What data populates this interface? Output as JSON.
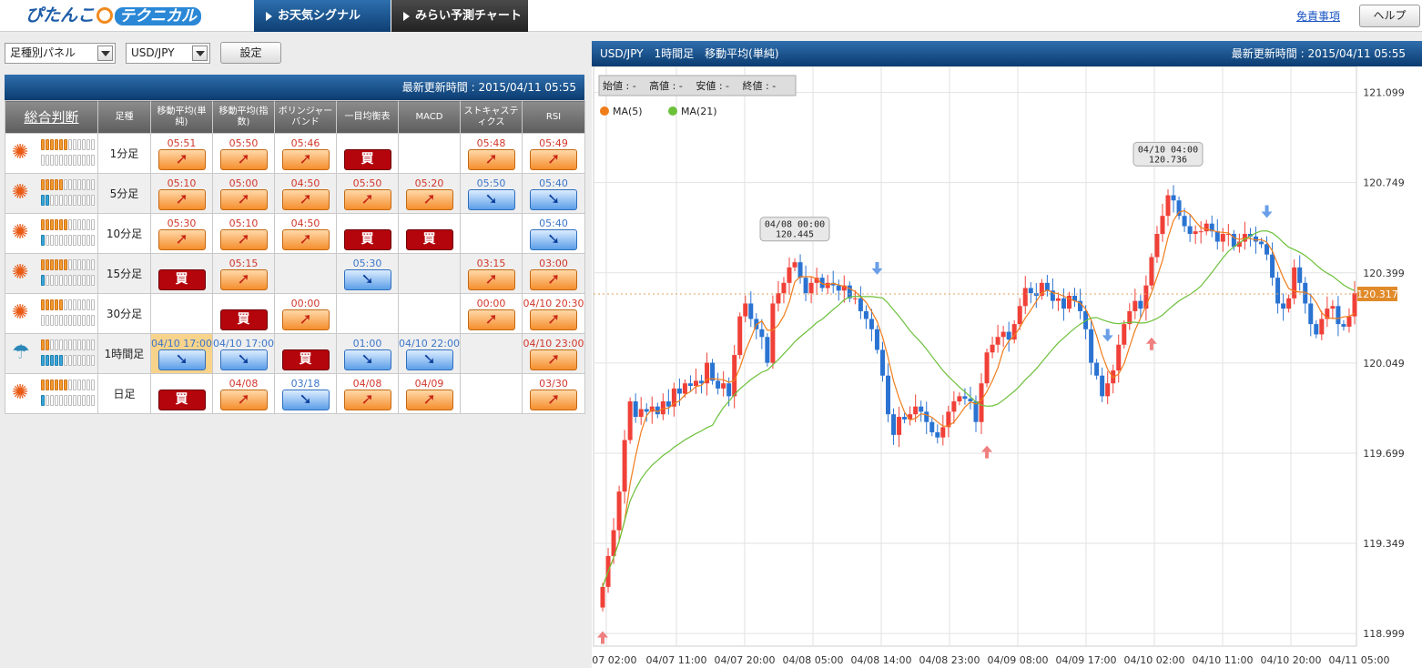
{
  "header": {
    "tab1": "お天気シグナル",
    "tab2": "みらい予測チャート",
    "disclaimer": "免責事項",
    "help": "ヘルプ"
  },
  "logo": {
    "a": "ぴたんこ",
    "b": "テクニカル"
  },
  "controls": {
    "panel": "足種別パネル",
    "pair": "USD/JPY",
    "settings": "設定"
  },
  "panel": {
    "updated": "最新更新時間 : 2015/04/11 05:55",
    "columns": [
      "総合判断",
      "足種",
      "移動平均(単純)",
      "移動平均(指数)",
      "ボリンジャーバンド",
      "一目均衡表",
      "MACD",
      "ストキャスティクス",
      "RSI"
    ],
    "rows": [
      {
        "tf": "1分足",
        "w": "sun",
        "up": 6,
        "dn": 0,
        "c": [
          [
            "05:51",
            "o"
          ],
          [
            "05:50",
            "o"
          ],
          [
            "05:46",
            "o"
          ],
          [
            "",
            "k"
          ],
          [
            "",
            ""
          ],
          [
            "05:48",
            "o"
          ],
          [
            "05:49",
            "o"
          ]
        ]
      },
      {
        "tf": "5分足",
        "w": "sun",
        "up": 5,
        "dn": 2,
        "c": [
          [
            "05:10",
            "o"
          ],
          [
            "05:00",
            "o"
          ],
          [
            "04:50",
            "o"
          ],
          [
            "05:50",
            "o"
          ],
          [
            "05:20",
            "o"
          ],
          [
            "05:50",
            "b"
          ],
          [
            "05:40",
            "b"
          ]
        ]
      },
      {
        "tf": "10分足",
        "w": "sun",
        "up": 6,
        "dn": 1,
        "c": [
          [
            "05:30",
            "o"
          ],
          [
            "05:10",
            "o"
          ],
          [
            "04:50",
            "o"
          ],
          [
            "",
            "k"
          ],
          [
            "",
            "k"
          ],
          [
            "",
            ""
          ],
          [
            "05:40",
            "b"
          ]
        ]
      },
      {
        "tf": "15分足",
        "w": "sun",
        "up": 6,
        "dn": 1,
        "c": [
          [
            "",
            "k"
          ],
          [
            "05:15",
            "o"
          ],
          [
            "",
            ""
          ],
          [
            "05:30",
            "b"
          ],
          [
            "",
            ""
          ],
          [
            "03:15",
            "o"
          ],
          [
            "03:00",
            "o"
          ]
        ]
      },
      {
        "tf": "30分足",
        "w": "sun",
        "up": 5,
        "dn": 0,
        "c": [
          [
            "",
            ""
          ],
          [
            "",
            "k"
          ],
          [
            "00:00",
            "o"
          ],
          [
            "",
            ""
          ],
          [
            "",
            ""
          ],
          [
            "00:00",
            "o"
          ],
          [
            "04/10 20:30",
            "o"
          ]
        ]
      },
      {
        "tf": "1時間足",
        "w": "umb",
        "up": 2,
        "dn": 5,
        "c": [
          [
            "04/10 17:00",
            "b"
          ],
          [
            "04/10 17:00",
            "b"
          ],
          [
            "",
            "k"
          ],
          [
            "01:00",
            "b"
          ],
          [
            "04/10 22:00",
            "b"
          ],
          [
            "",
            ""
          ],
          [
            "04/10 23:00",
            "o"
          ]
        ]
      },
      {
        "tf": "日足",
        "w": "sun",
        "up": 6,
        "dn": 1,
        "c": [
          [
            "",
            "k"
          ],
          [
            "04/08",
            "o"
          ],
          [
            "03/18",
            "b"
          ],
          [
            "04/08",
            "o"
          ],
          [
            "04/09",
            "o"
          ],
          [
            "",
            ""
          ],
          [
            "03/30",
            "o"
          ]
        ]
      }
    ],
    "buy": "買"
  },
  "chart": {
    "title": "USD/JPY　1時間足　移動平均(単純)",
    "updated": "最新更新時間 : 2015/04/11 05:55",
    "ohlc": "始値 : -　 高値 : -　 安値 : -　 終値 : -",
    "ma5": "MA(5)",
    "ma21": "MA(21)",
    "last": "120.317",
    "callout1": [
      "04/08 00:00",
      "120.445"
    ],
    "callout2": [
      "04/10 04:00",
      "120.736"
    ]
  },
  "chart_data": {
    "type": "candlestick",
    "title": "USD/JPY 1時間足 移動平均(単純)",
    "x_ticks": [
      "04/07 02:00",
      "04/07 11:00",
      "04/07 20:00",
      "04/08 05:00",
      "04/08 14:00",
      "04/08 23:00",
      "04/09 08:00",
      "04/09 17:00",
      "04/10 02:00",
      "04/10 11:00",
      "04/10 20:00",
      "04/11 05:00"
    ],
    "y_ticks": [
      121.099,
      120.749,
      120.399,
      120.049,
      119.699,
      119.349,
      118.999
    ],
    "ylim": [
      118.95,
      121.2
    ],
    "grid": true,
    "legend": "top-left",
    "series": [
      {
        "name": "MA(5)",
        "color": "#f07c1a"
      },
      {
        "name": "MA(21)",
        "color": "#6cc03a"
      }
    ],
    "close": [
      119.18,
      119.3,
      119.4,
      119.55,
      119.75,
      119.9,
      119.84,
      119.87,
      119.86,
      119.88,
      119.85,
      119.9,
      119.88,
      119.95,
      119.93,
      119.97,
      119.96,
      119.98,
      119.97,
      120.05,
      119.98,
      119.95,
      119.97,
      119.92,
      120.08,
      120.23,
      120.28,
      120.22,
      120.18,
      120.15,
      120.05,
      120.28,
      120.32,
      120.36,
      120.42,
      120.44,
      120.38,
      120.32,
      120.36,
      120.38,
      120.34,
      120.36,
      120.35,
      120.33,
      120.35,
      120.3,
      120.3,
      120.25,
      120.22,
      120.18,
      120.1,
      120.0,
      119.85,
      119.77,
      119.84,
      119.83,
      119.85,
      119.88,
      119.86,
      119.82,
      119.78,
      119.76,
      119.8,
      119.86,
      119.9,
      119.92,
      119.91,
      119.9,
      119.82,
      119.97,
      120.09,
      120.12,
      120.15,
      120.17,
      120.14,
      120.2,
      120.27,
      120.34,
      120.32,
      120.31,
      120.36,
      120.33,
      120.29,
      120.3,
      120.26,
      120.31,
      120.29,
      120.25,
      120.18,
      120.05,
      120.0,
      119.92,
      119.97,
      120.02,
      120.12,
      120.2,
      120.25,
      120.29,
      120.26,
      120.35,
      120.46,
      120.55,
      120.62,
      120.7,
      120.68,
      120.62,
      120.58,
      120.55,
      120.56,
      120.56,
      120.59,
      120.56,
      120.52,
      120.55,
      120.55,
      120.5,
      120.52,
      120.55,
      120.54,
      120.52,
      120.51,
      120.47,
      120.38,
      120.28,
      120.26,
      120.3,
      120.42,
      120.36,
      120.28,
      120.2,
      120.16,
      120.22,
      120.26,
      120.27,
      120.2,
      120.19,
      120.23,
      120.32
    ]
  }
}
